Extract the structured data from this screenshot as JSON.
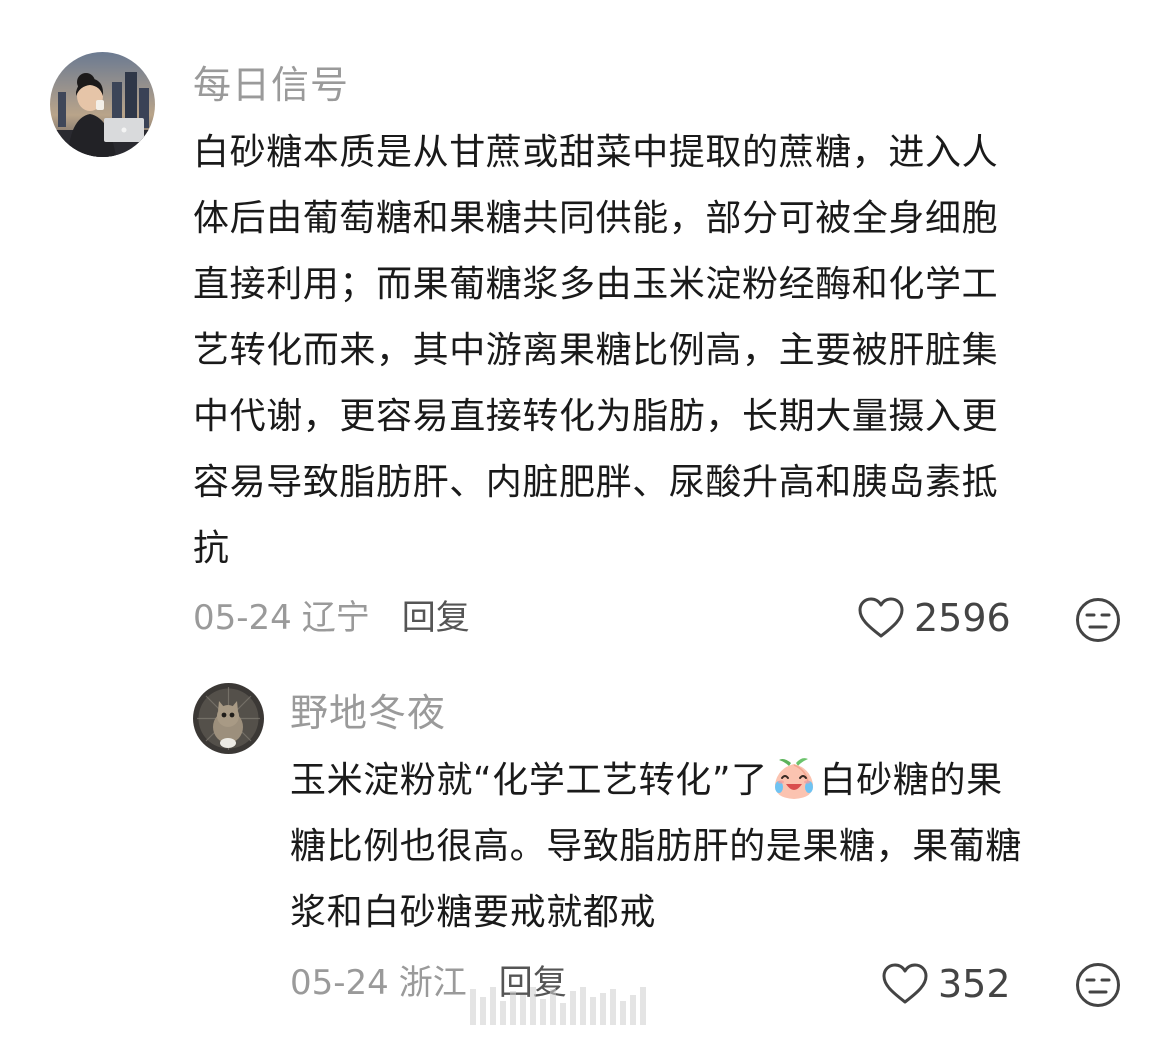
{
  "comments": [
    {
      "username": "每日信号",
      "avatar": "avatar-woman-with-laptop",
      "lines": [
        "白砂糖本质是从甘蔗或甜菜中提取的蔗糖，进入人",
        "体后由葡萄糖和果糖共同供能，部分可被全身细胞",
        "直接利用；而果葡糖浆多由玉米淀粉经酶和化学工",
        "艺转化而来，其中游离果糖比例高，主要被肝脏集",
        "中代谢，更容易直接转化为脂肪，长期大量摄入更",
        "容易导致脂肪肝、内脏肥胖、尿酸升高和胰岛素抵",
        "抗"
      ],
      "date": "05-24",
      "location": "辽宁",
      "reply_label": "回复",
      "likes": "2596",
      "like_icon": "heart-outline-icon",
      "reaction_icon": "unamused-face-icon"
    },
    {
      "username": "野地冬夜",
      "avatar": "avatar-cat",
      "line1_before_emoji": "玉米淀粉就“化学工艺转化”了",
      "emoji": "crying-laughing-peach-emoji",
      "line1_after_emoji": "白砂糖的果",
      "lines": [
        "糖比例也很高。导致脂肪肝的是果糖，果葡糖",
        "浆和白砂糖要戒就都戒"
      ],
      "date": "05-24",
      "location": "浙江",
      "reply_label": "回复",
      "likes": "352",
      "like_icon": "heart-outline-icon",
      "reaction_icon": "unamused-face-icon"
    }
  ],
  "watermark_icon": "barcode-watermark"
}
